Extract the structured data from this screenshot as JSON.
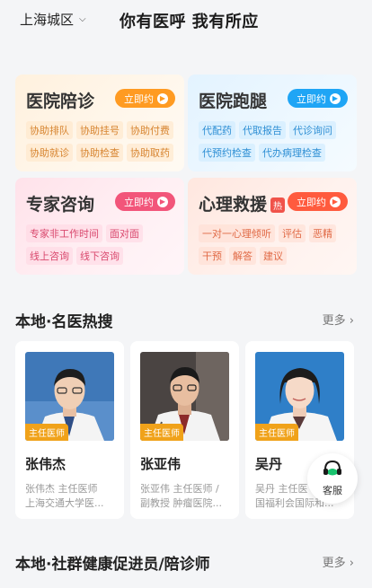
{
  "header": {
    "city": "上海城区",
    "slogan": "你有医呼 我有所应"
  },
  "services": [
    {
      "title": "医院陪诊",
      "button": "立即约",
      "tag_rows": [
        [
          "协助排队",
          "协助挂号",
          "协助付费"
        ],
        [
          "协助就诊",
          "协助检查",
          "协助取药"
        ]
      ]
    },
    {
      "title": "医院跑腿",
      "button": "立即约",
      "tag_rows": [
        [
          "代配药",
          "代取报告",
          "代诊询问"
        ],
        [
          "代预约检查",
          "代办病理检查"
        ]
      ]
    },
    {
      "title": "专家咨询",
      "button": "立即约",
      "tag_rows": [
        [
          "专家非工作时间",
          "面对面"
        ],
        [
          "线上咨询",
          "线下咨询"
        ]
      ]
    },
    {
      "title": "心理救援",
      "hot": "热",
      "button": "立即约",
      "tag_rows": [
        [
          "一对一心理倾听",
          "评估",
          "恶精"
        ],
        [
          "干预",
          "解答",
          "建议"
        ]
      ]
    }
  ],
  "famous_doctors": {
    "title": "本地·名医热搜",
    "more": "更多",
    "doctors": [
      {
        "name": "张伟杰",
        "badge": "主任医师",
        "line1": "张伟杰 主任医师",
        "line2": "上海交通大学医..."
      },
      {
        "name": "张亚伟",
        "badge": "主任医师",
        "line1": "张亚伟 主任医师 /",
        "line2": "副教授 肿瘤医院..."
      },
      {
        "name": "吴丹",
        "badge": "主任医师",
        "line1": "吴丹 主任医",
        "line2": "国福利会国际和..."
      }
    ]
  },
  "community": {
    "title": "本地·社群健康促进员/陪诊师",
    "more": "更多"
  },
  "customer_service": {
    "label": "客服"
  },
  "colors": {
    "orange": "#ff9b22",
    "blue": "#1fa5f5",
    "pink": "#f2557a",
    "red": "#ff5b3e",
    "badge": "#f0a21a"
  }
}
